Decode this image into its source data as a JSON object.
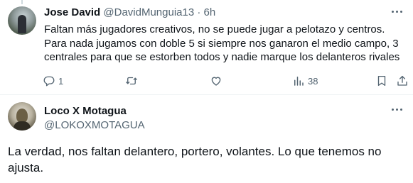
{
  "reply": {
    "author_name": "Jose David",
    "author_handle": "@DavidMunguia13",
    "separator": "·",
    "time": "6h",
    "text": "Faltan más jugadores creativos, no se puede jugar a pelotazo y centros. Para nada jugamos con doble 5 si siempre nos ganaron el medio campo, 3 centrales para que se estorben todos y nadie marque los delanteros rivales",
    "actions": {
      "reply_count": "1",
      "retweet_count": "",
      "like_count": "",
      "views_count": "38"
    }
  },
  "main": {
    "author_name": "Loco X Motagua",
    "author_handle": "@LOKOXMOTAGUA",
    "text": "La verdad, nos faltan delantero, portero, volantes. Lo que tenemos no ajusta."
  },
  "icons": {
    "reply": "reply-icon",
    "retweet": "retweet-icon",
    "like": "heart-icon",
    "views": "views-icon",
    "bookmark": "bookmark-icon",
    "share": "share-icon",
    "more": "more-icon"
  },
  "colors": {
    "text": "#0f1419",
    "muted": "#536471",
    "divider": "#eff3f4",
    "background": "#ffffff"
  }
}
